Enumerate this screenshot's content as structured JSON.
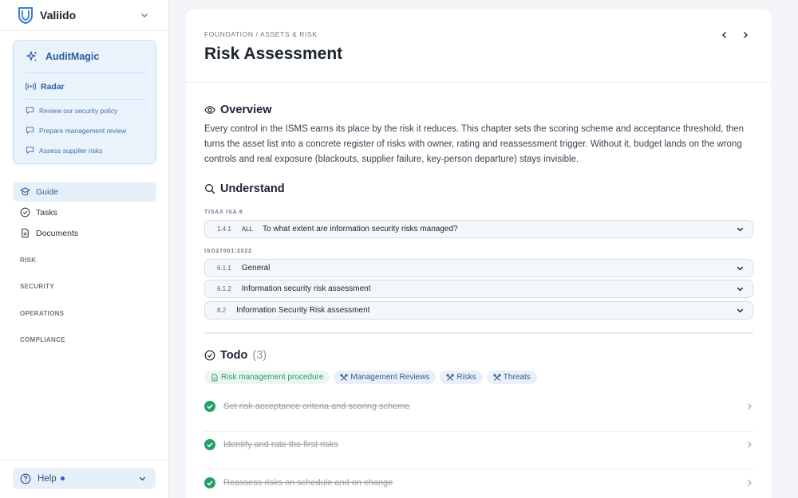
{
  "brand": {
    "name": "Valiido"
  },
  "auditmagic": {
    "title": "AuditMagic",
    "radar_label": "Radar",
    "links": [
      {
        "label": "Review our security policy"
      },
      {
        "label": "Prepare management review"
      },
      {
        "label": "Assess supplier risks"
      }
    ]
  },
  "nav": {
    "items": [
      {
        "label": "Guide",
        "icon": "graduation-cap-icon",
        "active": true
      },
      {
        "label": "Tasks",
        "icon": "check-circle-icon",
        "active": false
      },
      {
        "label": "Documents",
        "icon": "document-icon",
        "active": false
      }
    ],
    "sections": [
      "RISK",
      "SECURITY",
      "OPERATIONS",
      "COMPLIANCE"
    ]
  },
  "help": {
    "label": "Help"
  },
  "page": {
    "breadcrumb": "FOUNDATION / ASSETS & RISK",
    "title": "Risk Assessment"
  },
  "overview": {
    "heading": "Overview",
    "text": "Every control in the ISMS earns its place by the risk it reduces. This chapter sets the scoring scheme and acceptance threshold, then turns the asset list into a concrete register of risks with owner, rating and reassessment trigger. Without it, budget lands on the wrong controls and real exposure (blackouts, supplier failure, key-person departure) stays invisible."
  },
  "understand": {
    "heading": "Understand",
    "groups": [
      {
        "label": "TISAX ISA 6",
        "items": [
          {
            "id": "1.4.1",
            "tag": "ALL",
            "title": "To what extent are information security risks managed?"
          }
        ]
      },
      {
        "label": "ISO27001:2022",
        "items": [
          {
            "id": "6.1.1",
            "title": "General"
          },
          {
            "id": "6.1.2",
            "title": "Information security risk assessment"
          },
          {
            "id": "8.2",
            "title": "Information Security Risk assessment"
          }
        ]
      }
    ]
  },
  "todo": {
    "heading": "Todo",
    "count": "(3)",
    "pills": [
      {
        "label": "Risk management procedure",
        "icon": "document-icon",
        "color": "#2f9a61"
      },
      {
        "label": "Management Reviews",
        "icon": "tools-icon",
        "color": "#2f5b95"
      },
      {
        "label": "Risks",
        "icon": "tools-icon",
        "color": "#2f5b95"
      },
      {
        "label": "Threats",
        "icon": "tools-icon",
        "color": "#2f5b95"
      }
    ],
    "items": [
      {
        "label": "Set risk acceptance criteria and scoring scheme",
        "done": true
      },
      {
        "label": "Identify and rate the first risks",
        "done": true
      },
      {
        "label": "Reassess risks on schedule and on change",
        "done": true
      }
    ]
  },
  "colors": {
    "accent": "#2a5d9f",
    "success": "#22a267",
    "card_bg": "#eaf2fb"
  }
}
